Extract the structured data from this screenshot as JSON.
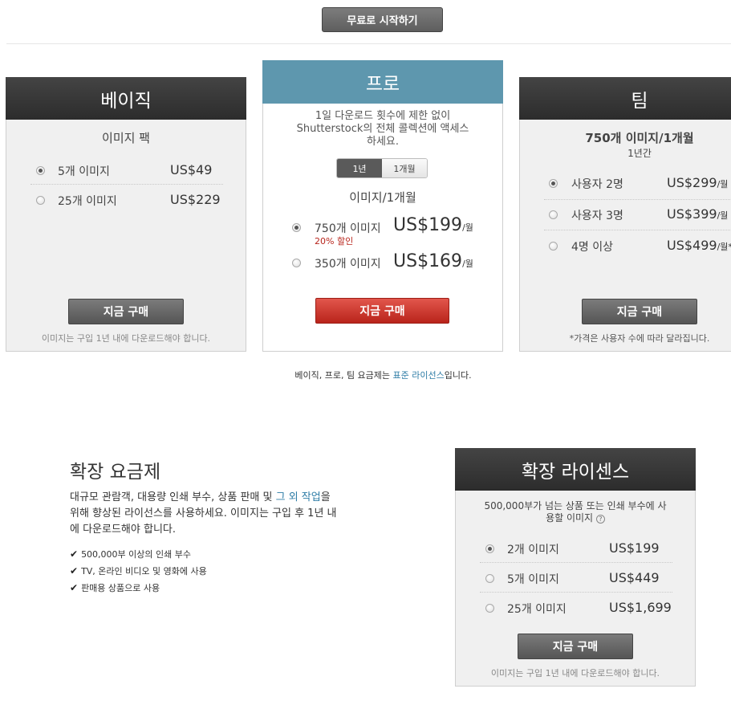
{
  "top": {
    "start_free_label": "무료로 시작하기"
  },
  "basic": {
    "title": "베이직",
    "subtitle": "이미지 팩",
    "options": [
      {
        "label": "5개 이미지",
        "price": "US$49",
        "selected": true
      },
      {
        "label": "25개 이미지",
        "price": "US$229",
        "selected": false
      }
    ],
    "buy_label": "지금 구매",
    "note": "이미지는 구입 1년 내에 다운로드해야 합니다."
  },
  "pro": {
    "title": "프로",
    "description_line1": "1일 다운로드 횟수에 제한 없이",
    "description_line2": "Shutterstock의 전체 콜렉션에 액세스",
    "description_line3": "하세요.",
    "toggle": {
      "year": "1년",
      "month": "1개월"
    },
    "subtitle": "이미지/1개월",
    "options": [
      {
        "label": "750개 이미지",
        "discount": "20% 할인",
        "price": "US$199",
        "unit": "/월",
        "selected": true
      },
      {
        "label": "350개 이미지",
        "price": "US$169",
        "unit": "/월",
        "selected": false
      }
    ],
    "buy_label": "지금 구매"
  },
  "team": {
    "title": "팀",
    "subtitle": "750개 이미지/1개월",
    "period": "1년간",
    "options": [
      {
        "label": "사용자 2명",
        "price": "US$299",
        "unit": "/월",
        "selected": true
      },
      {
        "label": "사용자 3명",
        "price": "US$399",
        "unit": "/월",
        "selected": false
      },
      {
        "label": "4명 이상",
        "price": "US$499",
        "unit": "/월*",
        "selected": false
      }
    ],
    "buy_label": "지금 구매",
    "note": "*가격은 사용자 수에 따라 달라집니다."
  },
  "license_note": {
    "prefix": "베이직, 프로, 팀 요금제는 ",
    "link": "표준 라이선스",
    "suffix": "입니다."
  },
  "extended": {
    "heading": "확장 요금제",
    "para_prefix": "대규모 관람객, 대용량 인쇄 부수, 상품 판매 및 ",
    "para_link": "그 외 작업",
    "para_after_link": "을",
    "para_line2": "위해 향상된 라이선스를 사용하세요. 이미지는 구입 후 1년 내",
    "para_line3": "에 다운로드해야 합니다.",
    "checks": [
      "500,000부 이상의 인쇄 부수",
      "TV, 온라인 비디오 및 영화에 사용",
      "판매용 상품으로 사용"
    ]
  },
  "ext_license": {
    "title": "확장 라이센스",
    "description_line1": "500,000부가 넘는 상품 또는 인쇄 부수에 사",
    "description_line2": "용할 이미지",
    "help_icon": "?",
    "options": [
      {
        "label": "2개 이미지",
        "price": "US$199",
        "selected": true
      },
      {
        "label": "5개 이미지",
        "price": "US$449",
        "selected": false
      },
      {
        "label": "25개 이미지",
        "price": "US$1,699",
        "selected": false
      }
    ],
    "buy_label": "지금 구매",
    "note": "이미지는 구입 1년 내에 다운로드해야 합니다."
  }
}
